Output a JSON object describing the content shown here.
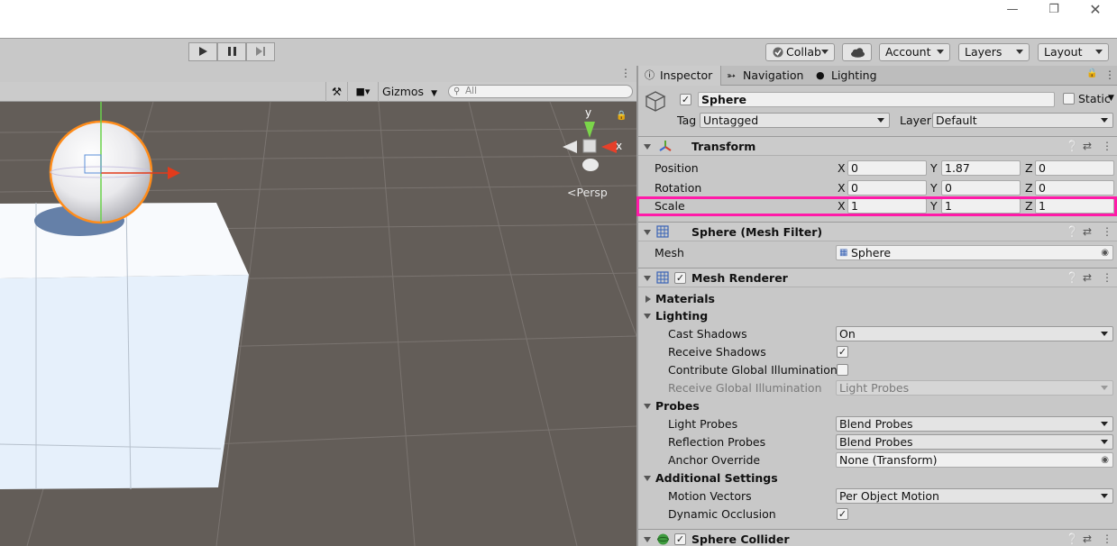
{
  "toolbar": {
    "collab": "Collab",
    "account": "Account",
    "layers": "Layers",
    "layout": "Layout"
  },
  "scene": {
    "gizmos": "Gizmos",
    "search_placeholder": "All",
    "axis_y": "y",
    "axis_x": "x",
    "persp": "Persp"
  },
  "inspector": {
    "tabs": [
      "Inspector",
      "Navigation",
      "Lighting"
    ],
    "object_name": "Sphere",
    "static_label": "Static",
    "tag_label": "Tag",
    "tag_value": "Untagged",
    "layer_label": "Layer",
    "layer_value": "Default",
    "transform": {
      "title": "Transform",
      "position": {
        "label": "Position",
        "x": "0",
        "y": "1.87",
        "z": "0"
      },
      "rotation": {
        "label": "Rotation",
        "x": "0",
        "y": "0",
        "z": "0"
      },
      "scale": {
        "label": "Scale",
        "x": "1",
        "y": "1",
        "z": "1"
      }
    },
    "axis": {
      "x": "X",
      "y": "Y",
      "z": "Z"
    },
    "mesh_filter": {
      "title": "Sphere (Mesh Filter)",
      "mesh_label": "Mesh",
      "mesh_value": "Sphere"
    },
    "mesh_renderer": {
      "title": "Mesh Renderer",
      "materials": "Materials",
      "lighting": "Lighting",
      "cast_shadows_label": "Cast Shadows",
      "cast_shadows_value": "On",
      "receive_shadows_label": "Receive Shadows",
      "contribute_gi_label": "Contribute Global Illumination",
      "receive_gi_label": "Receive Global Illumination",
      "receive_gi_value": "Light Probes",
      "probes": "Probes",
      "light_probes_label": "Light Probes",
      "light_probes_value": "Blend Probes",
      "reflection_probes_label": "Reflection Probes",
      "reflection_probes_value": "Blend Probes",
      "anchor_override_label": "Anchor Override",
      "anchor_override_value": "None (Transform)",
      "additional_settings": "Additional Settings",
      "motion_vectors_label": "Motion Vectors",
      "motion_vectors_value": "Per Object Motion",
      "dynamic_occlusion_label": "Dynamic Occlusion"
    },
    "sphere_collider": {
      "title": "Sphere Collider"
    }
  },
  "colors": {
    "highlight": "#ff1aa8",
    "scene_bg": "#635d58",
    "panel_bg": "#c8c8c8"
  }
}
